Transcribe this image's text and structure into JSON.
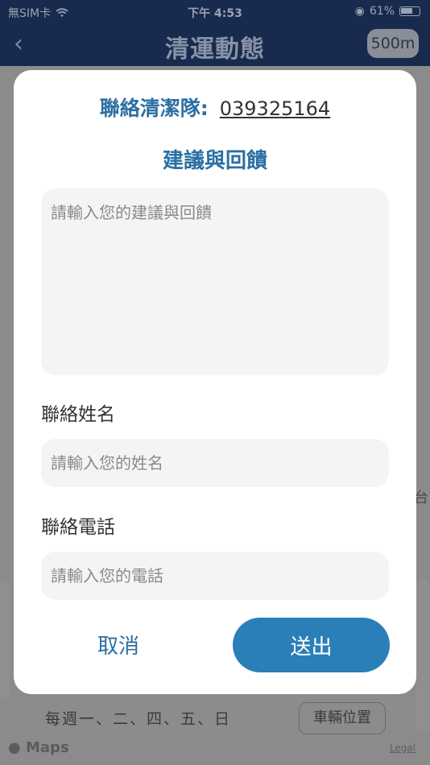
{
  "status_bar": {
    "carrier": "無SIM卡",
    "time": "下午 4:53",
    "battery": "61%"
  },
  "nav": {
    "title": "清運動態",
    "radius": "500m"
  },
  "background": {
    "schedule": "每週一、二、四、五、日",
    "vehicle_button": "車輛位置",
    "maps": "Maps",
    "legal": "Legal",
    "side_fragment": "台"
  },
  "modal": {
    "contact_label": "聯絡清潔隊:",
    "contact_phone": "039325164",
    "feedback_title": "建議與回饋",
    "feedback_placeholder": "請輸入您的建議與回饋",
    "name_label": "聯絡姓名",
    "name_placeholder": "請輸入您的姓名",
    "phone_label": "聯絡電話",
    "phone_placeholder": "請輸入您的電話",
    "cancel_label": "取消",
    "submit_label": "送出"
  },
  "colors": {
    "accent": "#2a6fa3",
    "submit_bg": "#2a7fb8",
    "nav_bg": "#182a4e",
    "input_bg": "#f4f4f4"
  }
}
